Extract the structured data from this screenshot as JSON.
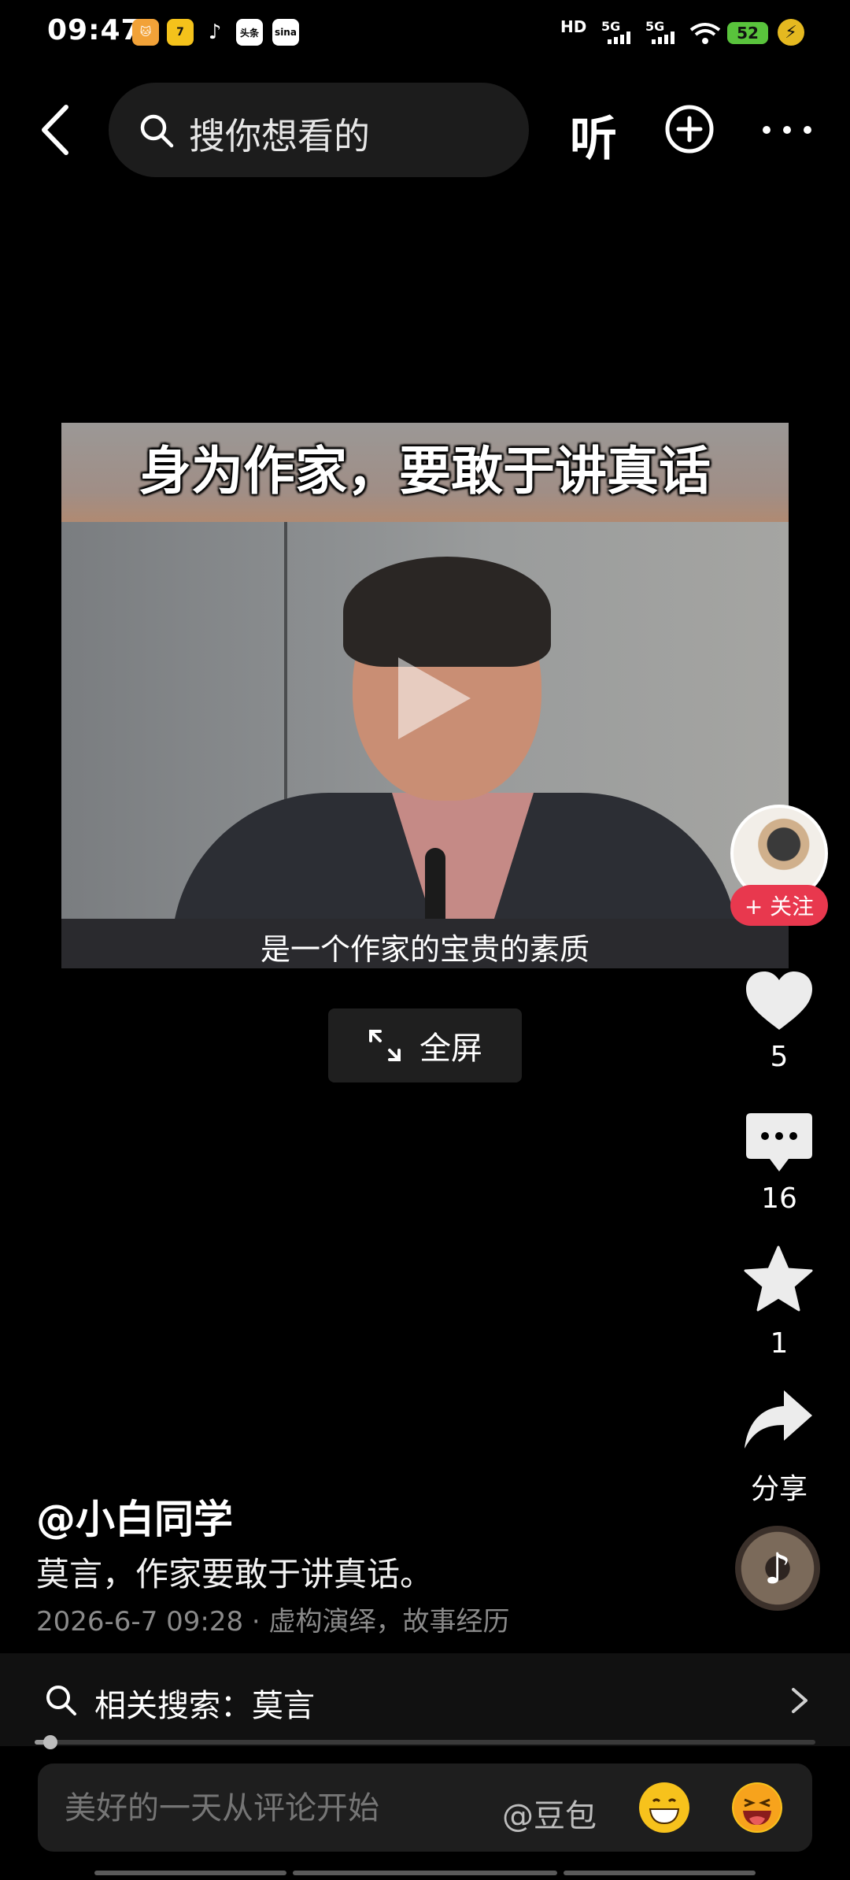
{
  "status_bar": {
    "time": "09:47",
    "app_icons": [
      "7",
      "头条",
      "sina"
    ],
    "signal_labels": [
      "HD",
      "5G",
      "5G"
    ],
    "battery": "52"
  },
  "top_nav": {
    "search_placeholder": "搜你想看的",
    "listen_label": "听"
  },
  "video": {
    "title_overlay": "身为作家，要敢于讲真话",
    "subtitle": "是一个作家的宝贵的素质",
    "fullscreen_label": "全屏"
  },
  "right_rail": {
    "follow_label": "+ 关注",
    "like_count": "5",
    "comment_count": "16",
    "favorite_count": "1",
    "share_label": "分享"
  },
  "post": {
    "author": "@小白同学",
    "description": "莫言，作家要敢于讲真话。",
    "meta": "2026-6-7 09:28 · 虚构演绎，故事经历"
  },
  "related_search": {
    "label": "相关搜索：莫言"
  },
  "playback": {
    "progress": 0.02
  },
  "comment_bar": {
    "placeholder": "美好的一天从评论开始",
    "mention": "@豆包"
  },
  "colors": {
    "follow_red": "#e8384e",
    "battery_green": "#59c33c"
  }
}
